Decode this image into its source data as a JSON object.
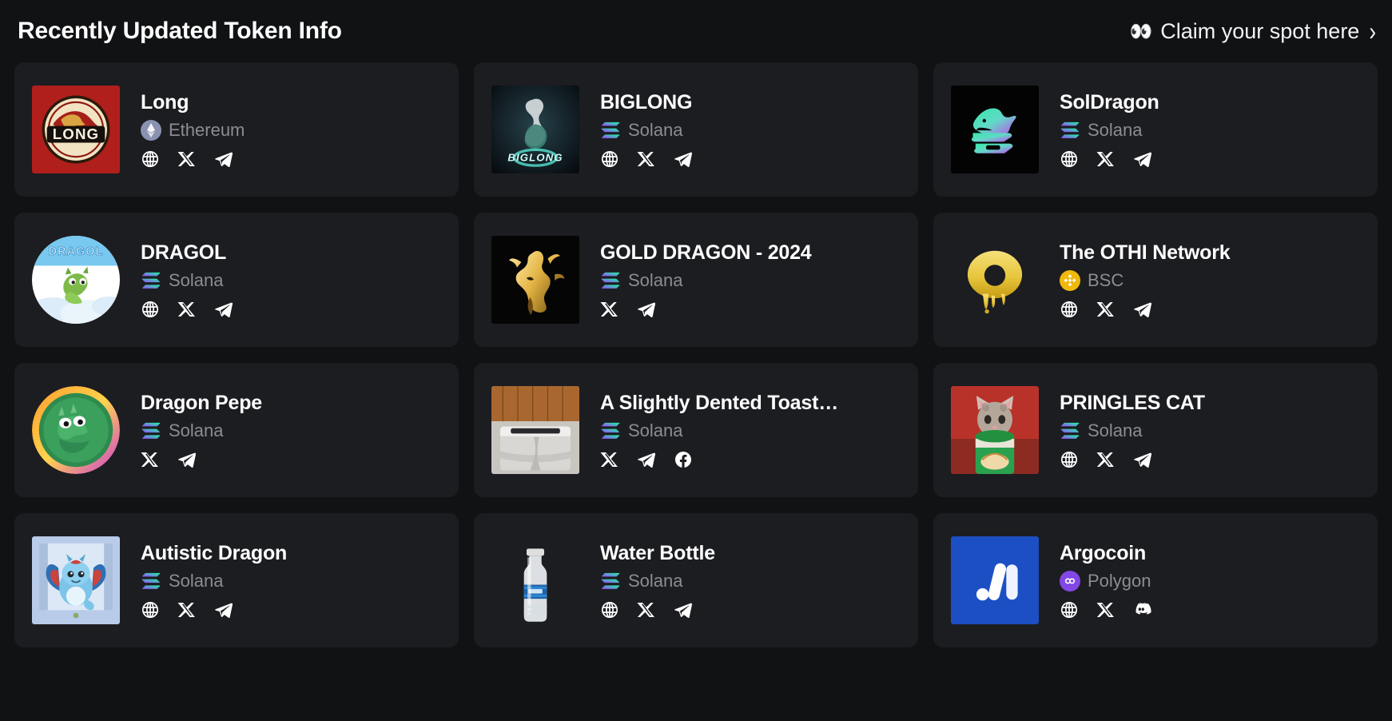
{
  "header": {
    "title": "Recently Updated Token Info",
    "claim_label": "Claim your spot here",
    "claim_eyes": "👀",
    "claim_chevron": "›"
  },
  "chains": {
    "ethereum": "Ethereum",
    "solana": "Solana",
    "bsc": "BSC",
    "polygon": "Polygon"
  },
  "accents": {
    "card_bg": "#1c1d21",
    "page_bg": "#111214",
    "title": "#ffffff",
    "muted": "#8b8d93",
    "solana_from": "#19fb9b",
    "solana_to": "#9945ff",
    "bsc": "#f0b90b",
    "polygon": "#8247e5",
    "ethereum": "#8a92b2"
  },
  "cards": [
    {
      "name": "Long",
      "chain": "Ethereum",
      "chain_icon": "ethereum-icon",
      "logo": "long-dragon-coin-logo",
      "socials": [
        "globe-icon",
        "x-icon",
        "telegram-icon"
      ]
    },
    {
      "name": "BIGLONG",
      "chain": "Solana",
      "chain_icon": "solana-icon",
      "logo": "biglong-dragon-logo",
      "socials": [
        "globe-icon",
        "x-icon",
        "telegram-icon"
      ]
    },
    {
      "name": "SolDragon",
      "chain": "Solana",
      "chain_icon": "solana-icon",
      "logo": "soldragon-head-logo",
      "socials": [
        "globe-icon",
        "x-icon",
        "telegram-icon"
      ]
    },
    {
      "name": "DRAGOL",
      "chain": "Solana",
      "chain_icon": "solana-icon",
      "logo": "dragol-cloud-logo",
      "socials": [
        "globe-icon",
        "x-icon",
        "telegram-icon"
      ]
    },
    {
      "name": "GOLD DRAGON - 2024",
      "chain": "Solana",
      "chain_icon": "solana-icon",
      "logo": "gold-dragon-logo",
      "socials": [
        "x-icon",
        "telegram-icon"
      ]
    },
    {
      "name": "The OTHI Network",
      "chain": "BSC",
      "chain_icon": "binance-icon",
      "logo": "othi-dripping-o-logo",
      "socials": [
        "globe-icon",
        "x-icon",
        "telegram-icon"
      ]
    },
    {
      "name": "Dragon Pepe",
      "chain": "Solana",
      "chain_icon": "solana-icon",
      "logo": "dragon-pepe-coin-logo",
      "socials": [
        "x-icon",
        "telegram-icon"
      ]
    },
    {
      "name": "A Slightly Dented Toast…",
      "chain": "Solana",
      "chain_icon": "solana-icon",
      "logo": "dented-toaster-photo",
      "socials": [
        "x-icon",
        "telegram-icon",
        "facebook-icon"
      ]
    },
    {
      "name": "PRINGLES CAT",
      "chain": "Solana",
      "chain_icon": "solana-icon",
      "logo": "pringles-cat-photo",
      "socials": [
        "globe-icon",
        "x-icon",
        "telegram-icon"
      ]
    },
    {
      "name": "Autistic Dragon",
      "chain": "Solana",
      "chain_icon": "solana-icon",
      "logo": "blue-dragon-art-logo",
      "socials": [
        "globe-icon",
        "x-icon",
        "telegram-icon"
      ]
    },
    {
      "name": "Water Bottle",
      "chain": "Solana",
      "chain_icon": "solana-icon",
      "logo": "water-bottle-photo",
      "socials": [
        "globe-icon",
        "x-icon",
        "telegram-icon"
      ]
    },
    {
      "name": "Argocoin",
      "chain": "Polygon",
      "chain_icon": "polygon-icon",
      "logo": "argocoin-m-logo",
      "socials": [
        "globe-icon",
        "x-icon",
        "discord-icon"
      ]
    }
  ]
}
